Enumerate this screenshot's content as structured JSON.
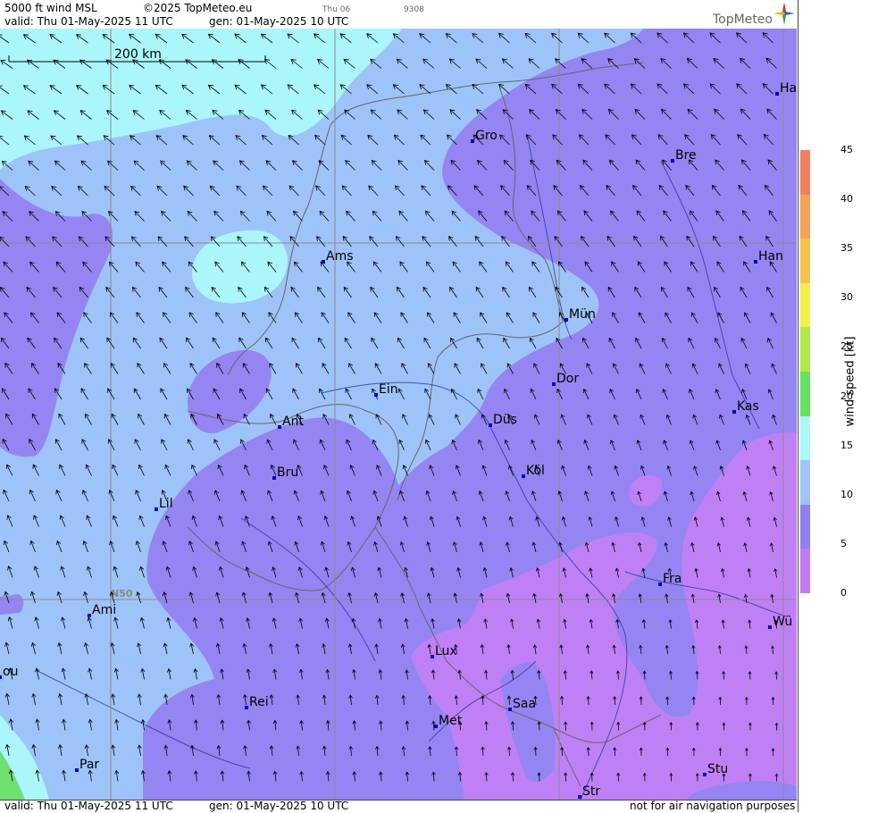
{
  "header": {
    "product": "5000 ft wind MSL",
    "copyright": "©2025 TopMeteo.eu",
    "valid": "valid:  Thu  01-May-2025  11 UTC",
    "generated": "gen: 01-May-2025 10 UTC",
    "day_small": "Thu 06",
    "code_small": "9308",
    "brand": "TopMeteo"
  },
  "footer": {
    "valid": "valid:  Thu  01-May-2025  11 UTC",
    "generated": "gen: 01-May-2025 10 UTC",
    "disclaimer": "not for air navigation purposes"
  },
  "scale_bar": {
    "label": "200 km"
  },
  "grid_label": "N50",
  "legend": {
    "title": "wind speed [kt]",
    "ticks": [
      "45",
      "40",
      "35",
      "30",
      "25",
      "20",
      "15",
      "10",
      "5",
      "0"
    ],
    "colors": [
      "#f08060",
      "#f5a25a",
      "#f5c24f",
      "#f2ee4a",
      "#b0e84a",
      "#66e060",
      "#aaf7f7",
      "#9fc5f7",
      "#8f7ff0",
      "#c37cf0"
    ]
  },
  "colors": {
    "calm": "#c080f5",
    "light": "#9585f2",
    "moderate": "#9ec3f8",
    "fresh": "#aaf6fa",
    "strong": "#6ee070"
  },
  "cities": [
    {
      "label": "Gro"
    },
    {
      "label": "Bre"
    },
    {
      "label": "Ha"
    },
    {
      "label": "Ams"
    },
    {
      "label": "Han"
    },
    {
      "label": "Mün"
    },
    {
      "label": "Dor"
    },
    {
      "label": "Ein"
    },
    {
      "label": "Kas"
    },
    {
      "label": "Ant"
    },
    {
      "label": "Düs"
    },
    {
      "label": "Bru"
    },
    {
      "label": "Köl"
    },
    {
      "label": "Lil"
    },
    {
      "label": "Fra"
    },
    {
      "label": "Ami"
    },
    {
      "label": "Wü"
    },
    {
      "label": "Lux"
    },
    {
      "label": "Rei"
    },
    {
      "label": "ou"
    },
    {
      "label": "Saa"
    },
    {
      "label": "Met"
    },
    {
      "label": "Par"
    },
    {
      "label": "Stu"
    },
    {
      "label": "Str"
    }
  ]
}
